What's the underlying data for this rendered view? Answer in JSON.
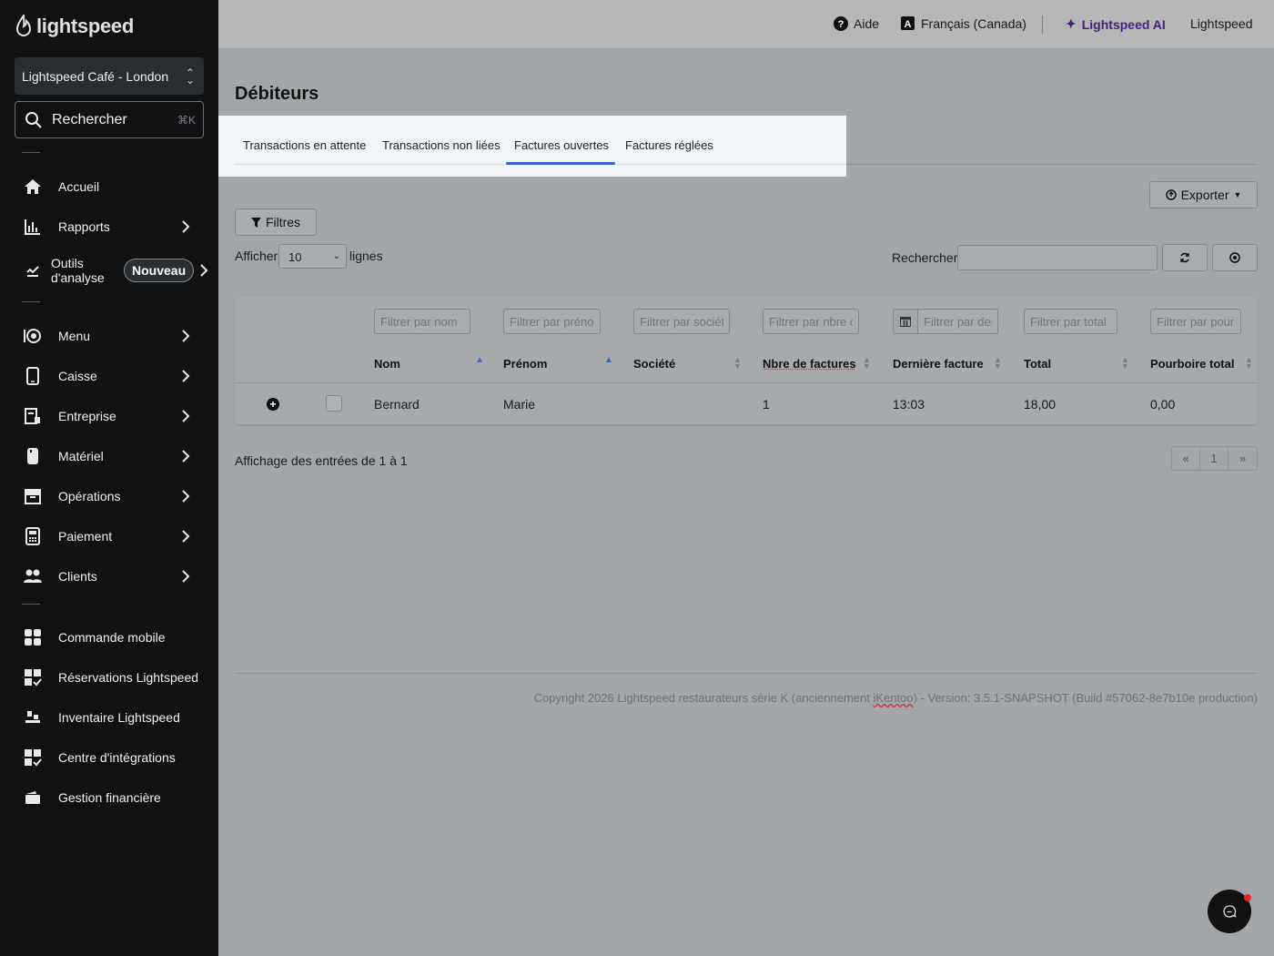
{
  "sidebar": {
    "logo_text": "lightspeed",
    "store": "Lightspeed Café - London",
    "search": {
      "label": "Rechercher",
      "shortcut": "⌘K"
    },
    "items": [
      {
        "label": "Accueil",
        "icon": "home-icon",
        "arrow": false
      },
      {
        "label": "Rapports",
        "icon": "bar-chart-icon",
        "arrow": true
      },
      {
        "label": "Outils d'analyse",
        "icon": "analytics-icon",
        "arrow": true,
        "badge": "Nouveau"
      },
      {
        "label": "Menu",
        "icon": "menu-icon",
        "arrow": true
      },
      {
        "label": "Caisse",
        "icon": "tablet-icon",
        "arrow": true
      },
      {
        "label": "Entreprise",
        "icon": "business-icon",
        "arrow": true
      },
      {
        "label": "Matériel",
        "icon": "hardware-icon",
        "arrow": true
      },
      {
        "label": "Opérations",
        "icon": "archive-icon",
        "arrow": true
      },
      {
        "label": "Paiement",
        "icon": "payment-terminal-icon",
        "arrow": true
      },
      {
        "label": "Clients",
        "icon": "users-icon",
        "arrow": true
      },
      {
        "label": "Commande mobile",
        "icon": "grid-icon",
        "arrow": false
      },
      {
        "label": "Réservations Lightspeed",
        "icon": "grid-check-icon",
        "arrow": false
      },
      {
        "label": "Inventaire Lightspeed",
        "icon": "inventory-icon",
        "arrow": false
      },
      {
        "label": "Centre d'intégrations",
        "icon": "integrations-icon",
        "arrow": false
      },
      {
        "label": "Gestion financière",
        "icon": "wallet-icon",
        "arrow": false
      }
    ]
  },
  "topbar": {
    "help": "Aide",
    "language": "Français (Canada)",
    "ai": "Lightspeed AI",
    "account": "Lightspeed"
  },
  "page": {
    "title": "Débiteurs",
    "tabs": [
      "Transactions en attente",
      "Transactions non liées",
      "Factures ouvertes",
      "Factures réglées"
    ],
    "active_tab": "Factures ouvertes",
    "export_label": "Exporter",
    "filters_label": "Filtres",
    "show_label": "Afficher",
    "rows_value": "10",
    "rows_label": "lignes",
    "search_label": "Rechercher:"
  },
  "table": {
    "filter_placeholders": [
      "Filtrer par nom",
      "Filtrer par préno",
      "Filtrer par sociét",
      "Filtrer par nbre c",
      "Filtrer par der",
      "Filtrer par total",
      "Filtrer par pour"
    ],
    "columns": [
      "Nom",
      "Prénom",
      "Société",
      "Nbre de factures",
      "Dernière facture",
      "Total",
      "Pourboire total"
    ],
    "rows": [
      {
        "nom": "Bernard",
        "prenom": "Marie",
        "societe": "",
        "nbre": "1",
        "derniere": "13:03",
        "total": "18,00",
        "pourboire": "0,00"
      }
    ],
    "info": "Affichage des entrées de 1 à 1",
    "pager": {
      "prev": "«",
      "page": "1",
      "next": "»"
    }
  },
  "footer": {
    "pre": "Copyright 2026 Lightspeed restaurateurs série K (anciennement ",
    "brand": "iKentoo",
    "post": ") - Version: 3.5.1-SNAPSHOT (Build #57062-8e7b10e production)"
  },
  "colors": {
    "accent": "#3b5fd6",
    "ai": "#4a1f7a",
    "sidebar": "#0f1113",
    "notification": "#e5242a"
  }
}
